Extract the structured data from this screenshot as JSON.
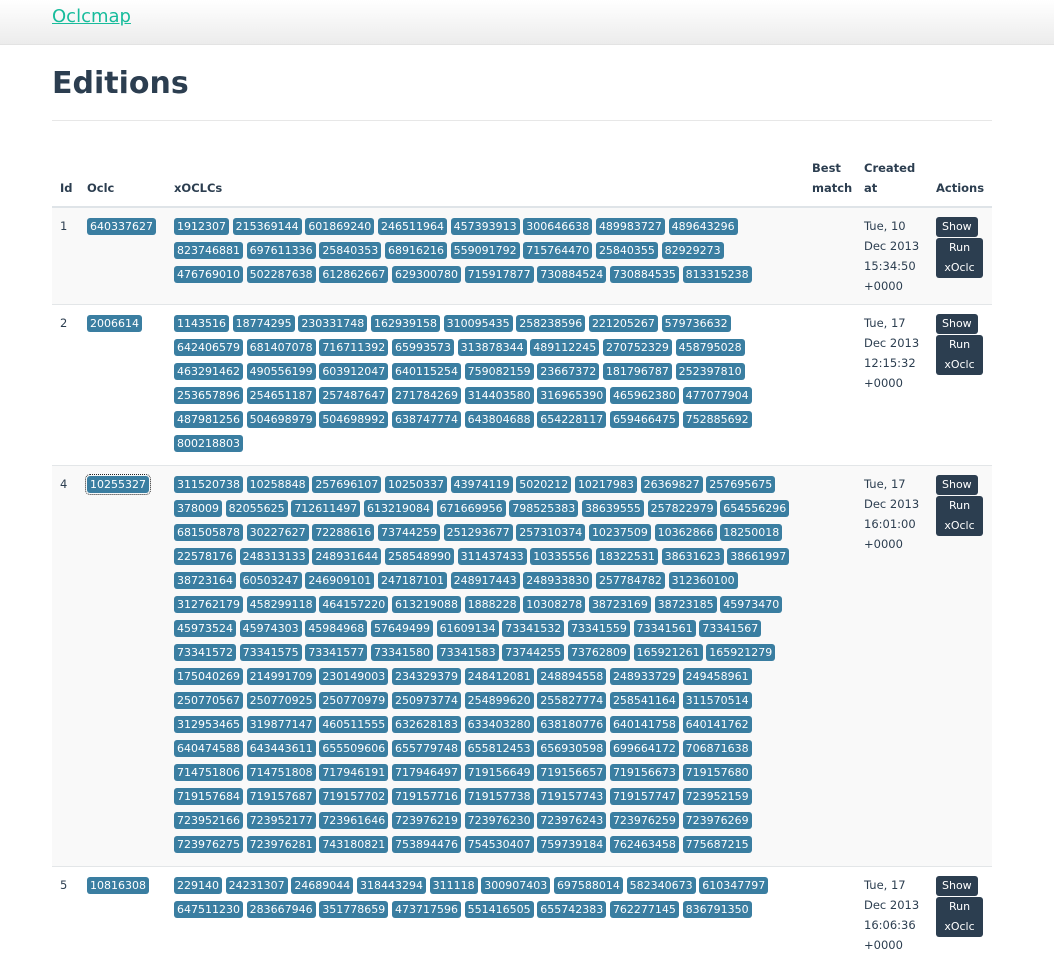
{
  "navbar": {
    "brand": "Oclcmap"
  },
  "page_title": "Editions",
  "table": {
    "headers": {
      "id": "Id",
      "oclc": "Oclc",
      "xoclcs": "xOCLCs",
      "best_match": "Best match",
      "created_at": "Created at",
      "actions": "Actions"
    },
    "action_labels": {
      "show": "Show",
      "run": "Run xOclc"
    },
    "rows": [
      {
        "id": "1",
        "oclc": "640337627",
        "created": "Tue, 10 Dec 2013 15:34:50 +0000",
        "xoclcs": [
          "1912307",
          "215369144",
          "601869240",
          "246511964",
          "457393913",
          "300646638",
          "489983727",
          "489643296",
          "823746881",
          "697611336",
          "25840353",
          "68916216",
          "559091792",
          "715764470",
          "25840355",
          "82929273",
          "476769010",
          "502287638",
          "612862667",
          "629300780",
          "715917877",
          "730884524",
          "730884535",
          "813315238"
        ]
      },
      {
        "id": "2",
        "oclc": "2006614",
        "created": "Tue, 17 Dec 2013 12:15:32 +0000",
        "xoclcs": [
          "1143516",
          "18774295",
          "230331748",
          "162939158",
          "310095435",
          "258238596",
          "221205267",
          "579736632",
          "642406579",
          "681407078",
          "716711392",
          "65993573",
          "313878344",
          "489112245",
          "270752329",
          "458795028",
          "463291462",
          "490556199",
          "603912047",
          "640115254",
          "759082159",
          "23667372",
          "181796787",
          "252397810",
          "253657896",
          "254651187",
          "257487647",
          "271784269",
          "314403580",
          "316965390",
          "465962380",
          "477077904",
          "487981256",
          "504698979",
          "504698992",
          "638747774",
          "643804688",
          "654228117",
          "659466475",
          "752885692",
          "800218803"
        ]
      },
      {
        "id": "4",
        "oclc": "10255327",
        "created": "Tue, 17 Dec 2013 16:01:00 +0000",
        "xoclcs": [
          "311520738",
          "10258848",
          "257696107",
          "10250337",
          "43974119",
          "5020212",
          "10217983",
          "26369827",
          "257695675",
          "378009",
          "82055625",
          "712611497",
          "613219084",
          "671669956",
          "798525383",
          "38639555",
          "257822979",
          "654556296",
          "681505878",
          "30227627",
          "72288616",
          "73744259",
          "251293677",
          "257310374",
          "10237509",
          "10362866",
          "18250018",
          "22578176",
          "248313133",
          "248931644",
          "258548990",
          "311437433",
          "10335556",
          "18322531",
          "38631623",
          "38661997",
          "38723164",
          "60503247",
          "246909101",
          "247187101",
          "248917443",
          "248933830",
          "257784782",
          "312360100",
          "312762179",
          "458299118",
          "464157220",
          "613219088",
          "1888228",
          "10308278",
          "38723169",
          "38723185",
          "45973470",
          "45973524",
          "45974303",
          "45984968",
          "57649499",
          "61609134",
          "73341532",
          "73341559",
          "73341561",
          "73341567",
          "73341572",
          "73341575",
          "73341577",
          "73341580",
          "73341583",
          "73744255",
          "73762809",
          "165921261",
          "165921279",
          "175040269",
          "214991709",
          "230149003",
          "234329379",
          "248412081",
          "248894558",
          "248933729",
          "249458961",
          "250770567",
          "250770925",
          "250770979",
          "250973774",
          "254899620",
          "255827774",
          "258541164",
          "311570514",
          "312953465",
          "319877147",
          "460511555",
          "632628183",
          "633403280",
          "638180776",
          "640141758",
          "640141762",
          "640474588",
          "643443611",
          "655509606",
          "655779748",
          "655812453",
          "656930598",
          "699664172",
          "706871638",
          "714751806",
          "714751808",
          "717946191",
          "717946497",
          "719156649",
          "719156657",
          "719156673",
          "719157680",
          "719157684",
          "719157687",
          "719157702",
          "719157716",
          "719157738",
          "719157743",
          "719157747",
          "723952159",
          "723952166",
          "723952177",
          "723961646",
          "723976219",
          "723976230",
          "723976243",
          "723976259",
          "723976269",
          "723976275",
          "723976281",
          "743180821",
          "753894476",
          "754530407",
          "759739184",
          "762463458",
          "775687215"
        ]
      },
      {
        "id": "5",
        "oclc": "10816308",
        "created": "Tue, 17 Dec 2013 16:06:36 +0000",
        "xoclcs": [
          "229140",
          "24231307",
          "24689044",
          "318443294",
          "311118",
          "300907403",
          "697588014",
          "582340673",
          "610347797",
          "647511230",
          "283667946",
          "351778659",
          "473717596",
          "551416505",
          "655742383",
          "762277145",
          "836791350"
        ]
      }
    ]
  }
}
